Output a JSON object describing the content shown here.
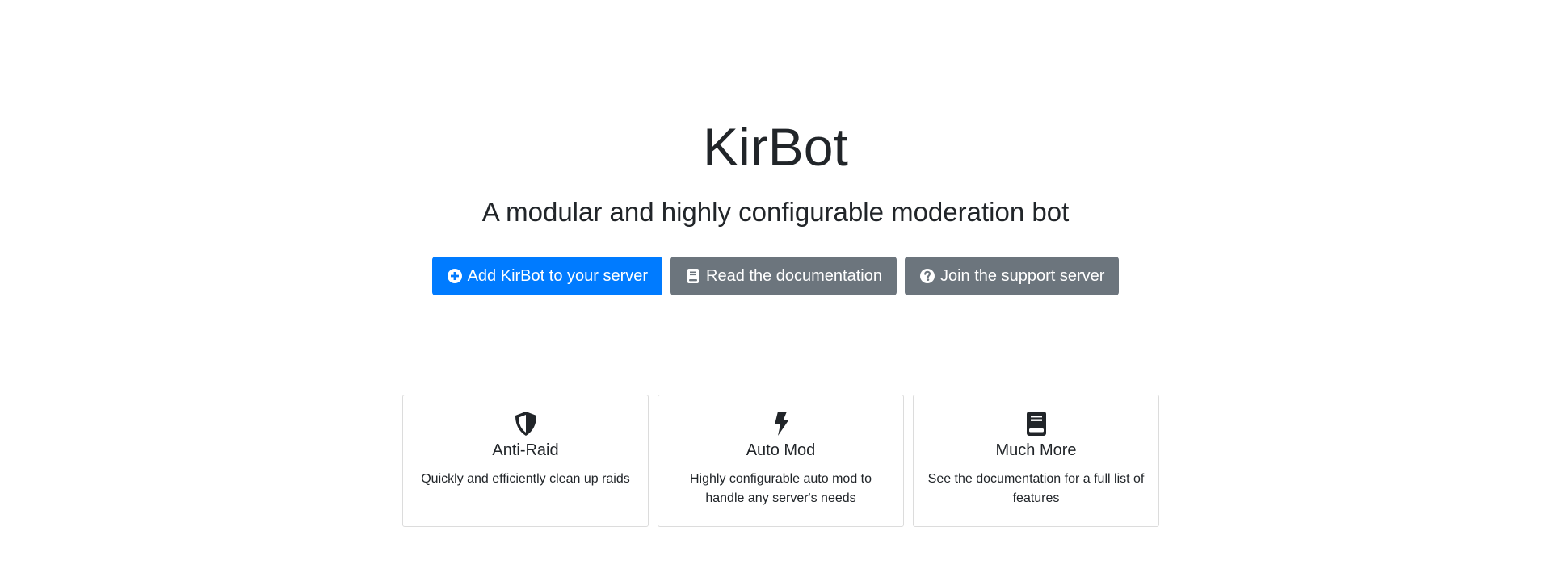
{
  "hero": {
    "title": "KirBot",
    "subtitle": "A modular and highly configurable moderation bot"
  },
  "actions": [
    {
      "label": "Add KirBot to your server",
      "icon": "plus-circle-icon",
      "style": "primary"
    },
    {
      "label": "Read the documentation",
      "icon": "book-icon",
      "style": "secondary"
    },
    {
      "label": "Join the support server",
      "icon": "question-circle-icon",
      "style": "secondary"
    }
  ],
  "features": [
    {
      "icon": "shield-icon",
      "title": "Anti-Raid",
      "text": "Quickly and efficiently clean up raids"
    },
    {
      "icon": "bolt-icon",
      "title": "Auto Mod",
      "text": "Highly configurable auto mod to handle any server's needs"
    },
    {
      "icon": "book-icon",
      "title": "Much More",
      "text": "See the documentation for a full list of features"
    }
  ],
  "colors": {
    "primary": "#007bff",
    "secondary": "#6c757d",
    "text": "#212529",
    "card_border": "#dcdcdc"
  }
}
